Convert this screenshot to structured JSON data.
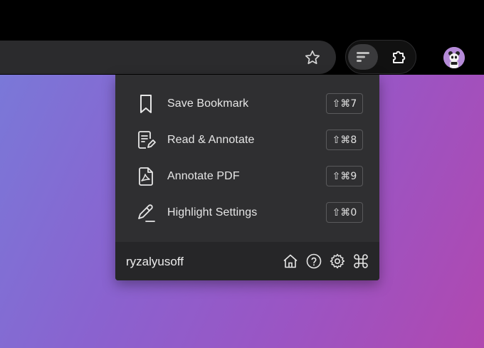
{
  "menu": {
    "items": [
      {
        "label": "Save Bookmark",
        "shortcut": "⇧⌘7",
        "icon": "bookmark-icon"
      },
      {
        "label": "Read & Annotate",
        "shortcut": "⇧⌘8",
        "icon": "document-edit-icon"
      },
      {
        "label": "Annotate PDF",
        "shortcut": "⇧⌘9",
        "icon": "pdf-icon"
      },
      {
        "label": "Highlight Settings",
        "shortcut": "⇧⌘0",
        "icon": "highlighter-icon"
      }
    ]
  },
  "footer": {
    "username": "ryzalyusoff",
    "icons": [
      "home-icon",
      "help-icon",
      "settings-icon",
      "command-icon"
    ]
  },
  "colors": {
    "toolbar": "#000000",
    "omnibox": "#2b2b2d",
    "popup": "#2f2f31",
    "footer": "#262628",
    "text": "#e6e6e6",
    "gradient_start": "#7a78d8",
    "gradient_end": "#b048b0"
  }
}
